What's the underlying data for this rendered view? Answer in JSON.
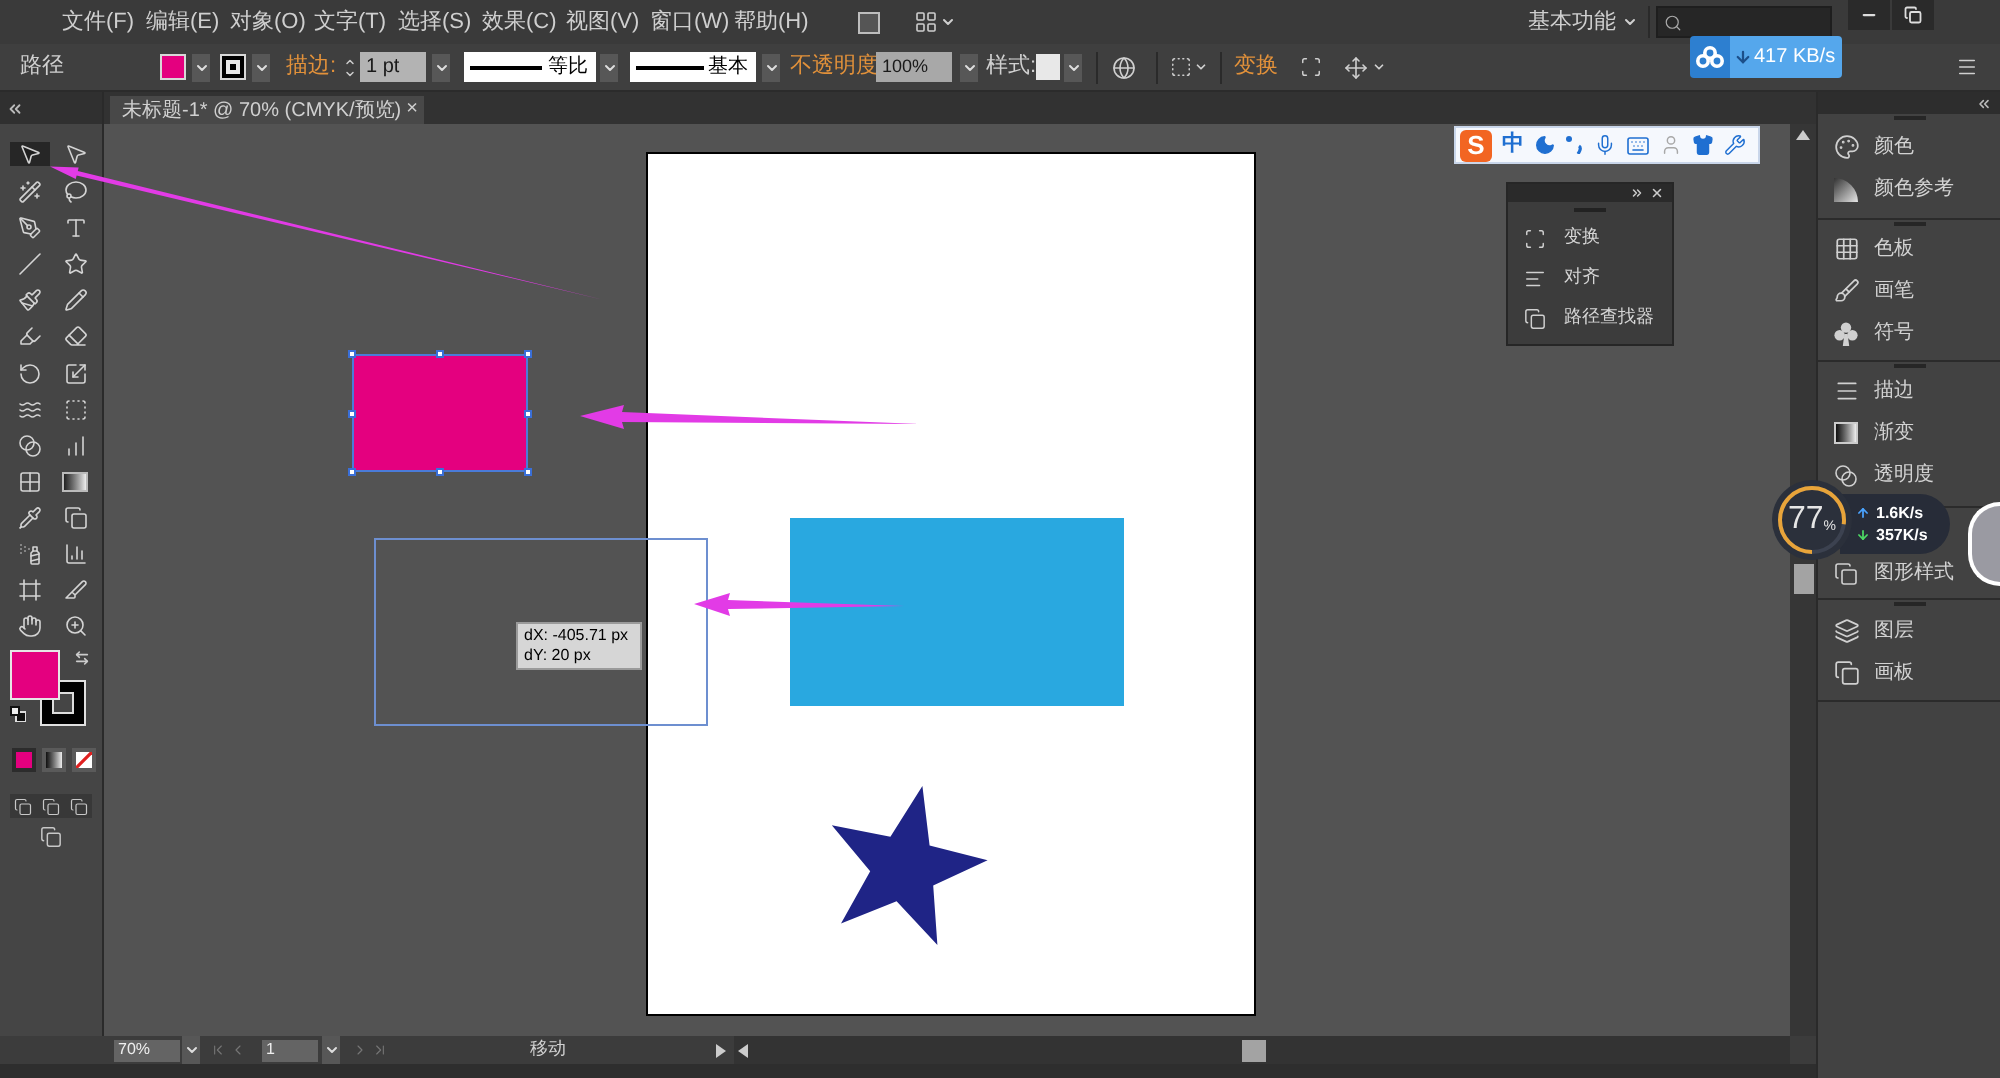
{
  "menu_bar": {
    "items": [
      "文件(F)",
      "编辑(E)",
      "对象(O)",
      "文字(T)",
      "选择(S)",
      "效果(C)",
      "视图(V)",
      "窗口(W)",
      "帮助(H)"
    ],
    "workspace": "基本功能"
  },
  "control_bar": {
    "selection_type": "路径",
    "fill": {
      "color": "#e4007f"
    },
    "stroke": {
      "color": "#000000"
    },
    "stroke_label": "描边:",
    "stroke_weight": "1 pt",
    "width_profile": "等比",
    "brush": "基本",
    "opacity_label": "不透明度",
    "opacity": "100%",
    "style_label": "样式:",
    "transform": "变换"
  },
  "download_widget": {
    "speed": "417 KB/s"
  },
  "document_tab": {
    "title": "未标题-1* @ 70% (CMYK/预览)",
    "close": "×"
  },
  "toolbar": {
    "tools": [
      {
        "kind": "selection",
        "selected": true
      },
      {
        "kind": "direct_selection",
        "selected": false
      },
      {
        "kind": "magic_wand",
        "selected": false
      },
      {
        "kind": "lasso",
        "selected": false
      },
      {
        "kind": "pen",
        "selected": false
      },
      {
        "kind": "type",
        "selected": false
      },
      {
        "kind": "line",
        "selected": false
      },
      {
        "kind": "star",
        "selected": false
      },
      {
        "kind": "paintbrush",
        "selected": false
      },
      {
        "kind": "pencil",
        "selected": false
      },
      {
        "kind": "blob_brush",
        "selected": false
      },
      {
        "kind": "eraser",
        "selected": false
      },
      {
        "kind": "rotate",
        "selected": false
      },
      {
        "kind": "scale",
        "selected": false
      },
      {
        "kind": "warp",
        "selected": false
      },
      {
        "kind": "free_transform",
        "selected": false
      },
      {
        "kind": "shape_builder",
        "selected": false
      },
      {
        "kind": "perspective_grid",
        "selected": false
      },
      {
        "kind": "mesh",
        "selected": false
      },
      {
        "kind": "gradient",
        "selected": false
      },
      {
        "kind": "eyedropper",
        "selected": false
      },
      {
        "kind": "blend",
        "selected": false
      },
      {
        "kind": "symbol_sprayer",
        "selected": false
      },
      {
        "kind": "column_graph",
        "selected": false
      },
      {
        "kind": "artboard",
        "selected": false
      },
      {
        "kind": "slice",
        "selected": false
      },
      {
        "kind": "hand",
        "selected": false
      },
      {
        "kind": "zoom",
        "selected": false
      }
    ],
    "fill": {
      "color": "#e4007f"
    },
    "stroke": {
      "color": "#000000"
    }
  },
  "canvas": {
    "shapes": [
      {
        "kind": "rectangle",
        "color": "#e4007f",
        "selected": true
      },
      {
        "kind": "rectangle",
        "color": "#29a8e0",
        "selected": false
      },
      {
        "kind": "star",
        "color": "#1f2486",
        "selected": false
      }
    ],
    "drag_preview": {
      "lines": [
        "dX: -405.71 px",
        "dY: 20 px"
      ]
    }
  },
  "ime_toolbar": {
    "logo": "S",
    "mode": "中"
  },
  "floating_panel": {
    "items": [
      {
        "kind": "transform",
        "label": "变换"
      },
      {
        "kind": "align",
        "label": "对齐"
      },
      {
        "kind": "pathfinder",
        "label": "路径查找器"
      }
    ]
  },
  "panel_dock": {
    "groups": [
      {
        "items": [
          {
            "kind": "color",
            "label": "颜色"
          },
          {
            "kind": "color_guide",
            "label": "颜色参考"
          }
        ]
      },
      {
        "items": [
          {
            "kind": "swatches",
            "label": "色板"
          },
          {
            "kind": "brushes",
            "label": "画笔"
          },
          {
            "kind": "symbols",
            "label": "符号"
          }
        ]
      },
      {
        "items": [
          {
            "kind": "stroke",
            "label": "描边"
          },
          {
            "kind": "gradient",
            "label": "渐变"
          },
          {
            "kind": "transparency",
            "label": "透明度"
          }
        ]
      },
      {
        "items": [
          {
            "kind": "graphic_styles",
            "label": "图形样式"
          }
        ]
      },
      {
        "items": [
          {
            "kind": "layers",
            "label": "图层"
          },
          {
            "kind": "artboards",
            "label": "画板"
          }
        ]
      }
    ]
  },
  "network_widget": {
    "usage": "77",
    "unit": "%",
    "level": 0.77,
    "upload": "1.6K/s",
    "download": "357K/s"
  },
  "status_bar": {
    "zoom": "70%",
    "artboard": "1",
    "tool": "移动"
  }
}
